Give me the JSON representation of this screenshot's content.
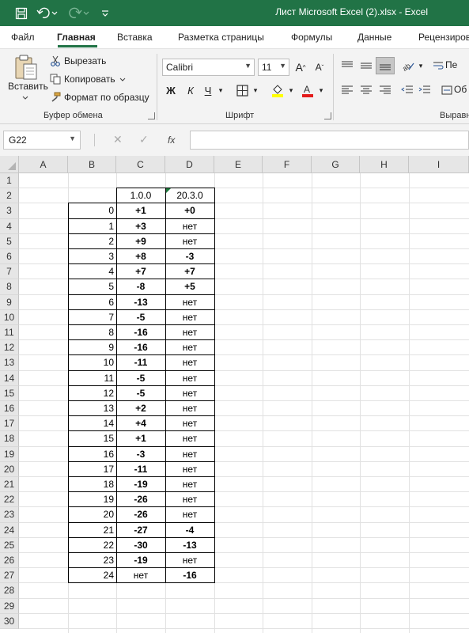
{
  "window": {
    "title": "Лист Microsoft Excel (2).xlsx  -  Excel"
  },
  "colors": {
    "brand": "#217346",
    "error_indicator": "#1e7b3d"
  },
  "ribbon_tabs": [
    "Файл",
    "Главная",
    "Вставка",
    "Разметка страницы",
    "Формулы",
    "Данные",
    "Рецензиров"
  ],
  "active_tab": "Главная",
  "clipboard": {
    "paste": "Вставить",
    "cut": "Вырезать",
    "copy": "Копировать",
    "format_painter": "Формат по образцу",
    "group_label": "Буфер обмена"
  },
  "font": {
    "name": "Calibri",
    "size": "11",
    "bold": "Ж",
    "italic": "К",
    "underline": "Ч",
    "group_label": "Шрифт"
  },
  "alignment": {
    "group_label": "Выравн",
    "wrap_partial": "Пе",
    "merge_partial": "Об"
  },
  "formula_bar": {
    "name_box": "G22",
    "fx": "fx",
    "formula": ""
  },
  "columns": [
    "A",
    "B",
    "C",
    "D",
    "E",
    "F",
    "G",
    "H",
    "I"
  ],
  "rows": [
    1,
    2,
    3,
    4,
    5,
    6,
    7,
    8,
    9,
    10,
    11,
    12,
    13,
    14,
    15,
    16,
    17,
    18,
    19,
    20,
    21,
    22,
    23,
    24,
    25,
    26,
    27,
    28,
    29,
    30
  ],
  "table": {
    "header_c": "1.0.0",
    "header_d": "20.3.0",
    "data": [
      [
        "0",
        "+1",
        "+0"
      ],
      [
        "1",
        "+3",
        "нет"
      ],
      [
        "2",
        "+9",
        "нет"
      ],
      [
        "3",
        "+8",
        "-3"
      ],
      [
        "4",
        "+7",
        "+7"
      ],
      [
        "5",
        "-8",
        "+5"
      ],
      [
        "6",
        "-13",
        "нет"
      ],
      [
        "7",
        "-5",
        "нет"
      ],
      [
        "8",
        "-16",
        "нет"
      ],
      [
        "9",
        "-16",
        "нет"
      ],
      [
        "10",
        "-11",
        "нет"
      ],
      [
        "11",
        "-5",
        "нет"
      ],
      [
        "12",
        "-5",
        "нет"
      ],
      [
        "13",
        "+2",
        "нет"
      ],
      [
        "14",
        "+4",
        "нет"
      ],
      [
        "15",
        "+1",
        "нет"
      ],
      [
        "16",
        "-3",
        "нет"
      ],
      [
        "17",
        "-11",
        "нет"
      ],
      [
        "18",
        "-19",
        "нет"
      ],
      [
        "19",
        "-26",
        "нет"
      ],
      [
        "20",
        "-26",
        "нет"
      ],
      [
        "21",
        "-27",
        "-4"
      ],
      [
        "22",
        "-30",
        "-13"
      ],
      [
        "23",
        "-19",
        "нет"
      ],
      [
        "24",
        "нет",
        "-16"
      ]
    ],
    "bold_values": [
      "+1",
      "+0",
      "+3",
      "+9",
      "+8",
      "-3",
      "+7",
      "-8",
      "+5",
      "-13",
      "-5",
      "-16",
      "-11",
      "+2",
      "+4",
      "-11",
      "-19",
      "-26",
      "-27",
      "-4",
      "-30",
      "-13"
    ]
  }
}
